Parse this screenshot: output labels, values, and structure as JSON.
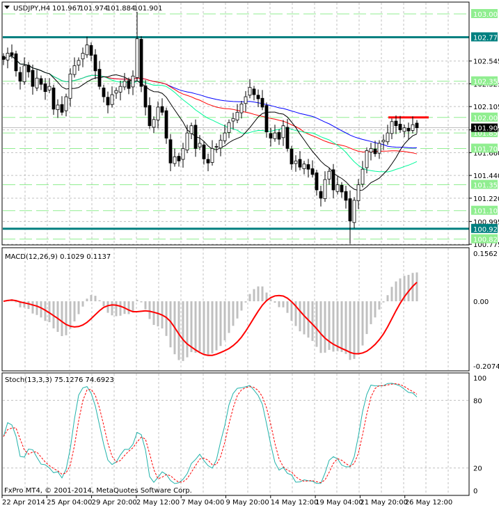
{
  "header": {
    "symbol": "USDJPY,H4",
    "open": "101.967",
    "high": "101.974",
    "low": "101.884",
    "close": "101.901"
  },
  "macd_label": "MACD(12,26,9) 0.1029 0.1137",
  "stoch_label": "Stoch(13,3,3) 75.1276 74.6923",
  "copyright": "FxPro MT4, © 2001-2014, MetaQuotes Software Corp.",
  "colors": {
    "teal": "#008080",
    "level_green": "#90EE90",
    "ma_blue": "#0000FF",
    "ma_red": "#FF0000",
    "ma_green": "#00FA9A",
    "ma_black": "#000000",
    "hist": "#C0C0C0"
  },
  "chart_data": {
    "type": "candlestick",
    "title": "USDJPY,H4",
    "ylim": [
      100.775,
      103.0
    ],
    "price_ticks": [
      "102.545",
      "102.325",
      "102.105",
      "101.880",
      "101.660",
      "101.440",
      "101.220",
      "100.995",
      "100.775"
    ],
    "levels_green": [
      "103.000",
      "102.350",
      "102.000",
      "101.850",
      "101.700",
      "101.350",
      "101.100",
      "100.825"
    ],
    "levels_teal": [
      "102.775",
      "100.925"
    ],
    "current_price": "101.901",
    "resistance_red": 102.0,
    "x_labels": [
      "22 Apr 2014",
      "25 Apr 04:00",
      "29 Apr 20:00",
      "2 May 12:00",
      "7 May 04:00",
      "9 May 20:00",
      "14 May 12:00",
      "19 May 04:00",
      "21 May 20:00",
      "26 May 12:00"
    ],
    "closes": [
      102.56,
      102.62,
      102.6,
      102.45,
      102.35,
      102.5,
      102.44,
      102.3,
      102.38,
      102.32,
      102.25,
      102.3,
      102.08,
      102.12,
      102.05,
      102.2,
      102.42,
      102.5,
      102.55,
      102.62,
      102.7,
      102.6,
      102.45,
      102.3,
      102.2,
      102.12,
      102.22,
      102.26,
      102.3,
      102.35,
      102.28,
      102.4,
      102.76,
      102.3,
      102.1,
      101.92,
      101.98,
      102.1,
      102.05,
      101.8,
      101.56,
      101.62,
      101.58,
      101.7,
      101.85,
      101.92,
      101.7,
      101.75,
      101.6,
      101.56,
      101.7,
      101.72,
      101.78,
      101.85,
      101.95,
      101.99,
      102.05,
      102.13,
      102.2,
      102.29,
      102.22,
      102.18,
      102.1,
      101.86,
      101.8,
      101.85,
      101.79,
      101.92,
      101.7,
      101.55,
      101.58,
      101.52,
      101.55,
      101.5,
      101.45,
      101.3,
      101.22,
      101.4,
      101.48,
      101.3,
      101.35,
      101.28,
      101.2,
      101.0,
      101.2,
      101.35,
      101.5,
      101.68,
      101.7,
      101.65,
      101.75,
      101.78,
      101.85,
      101.96,
      101.92,
      101.88,
      101.9,
      101.87,
      101.93,
      101.9
    ],
    "wick_overrides": [
      {
        "i": 32,
        "high": 103.02
      },
      {
        "i": 83,
        "low": 100.78
      }
    ],
    "moving_averages": [
      {
        "name": "MA blue",
        "period": 60,
        "color": "#0000FF"
      },
      {
        "name": "MA red",
        "period": 40,
        "color": "#FF0000"
      },
      {
        "name": "MA green",
        "period": 25,
        "color": "#00FA9A"
      },
      {
        "name": "MA black",
        "period": 12,
        "color": "#000000"
      }
    ],
    "macd": {
      "params": [
        12,
        26,
        9
      ],
      "ylim": [
        -0.2074,
        0.1562
      ],
      "ticks": [
        "0.1562",
        "0.00",
        "-0.2074"
      ]
    },
    "stoch": {
      "params": [
        13,
        3,
        3
      ],
      "ylim": [
        0,
        100
      ],
      "ticks": [
        "100",
        "80",
        "20",
        "0"
      ]
    }
  }
}
